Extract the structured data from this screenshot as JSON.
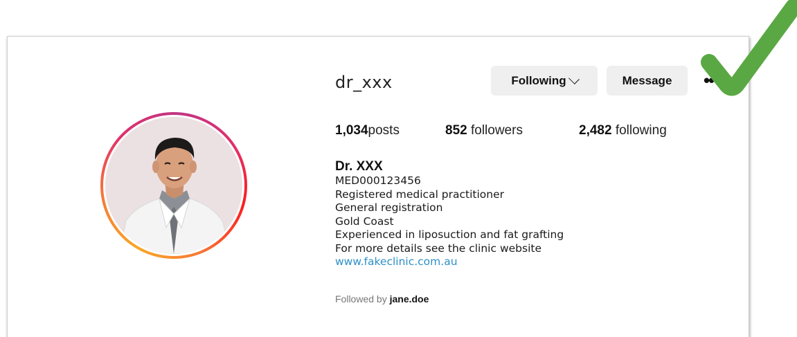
{
  "profile": {
    "username": "dr_xxx",
    "following_button": "Following",
    "message_button": "Message",
    "more_icon": "more-horizontal-icon"
  },
  "stats": {
    "posts_count": "1,034",
    "posts_label": "posts",
    "followers_count": "852",
    "followers_label": "followers",
    "following_count": "2,482",
    "following_label": "following"
  },
  "bio": {
    "name": "Dr. XXX",
    "lines": [
      "MED000123456",
      "Registered medical practitioner",
      "General registration",
      "Gold Coast",
      "Experienced in liposuction and fat grafting",
      "For more details see the clinic website"
    ],
    "website": "www.fakeclinic.com.au"
  },
  "followed_by": {
    "prefix": "Followed by",
    "user": "jane.doe"
  },
  "colors": {
    "link": "#2f8fc7",
    "button_bg": "#efefef",
    "check_green": "#5aa843"
  },
  "overlay": {
    "icon": "green-checkmark-icon"
  }
}
